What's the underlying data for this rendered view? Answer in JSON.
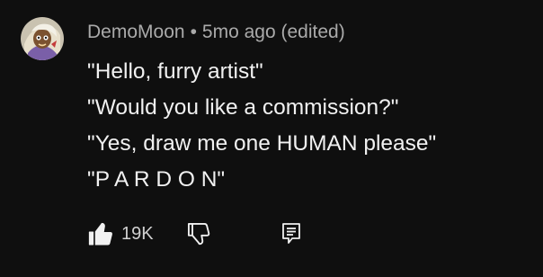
{
  "comment": {
    "author": "DemoMoon",
    "separator": "•",
    "timestamp": "5mo ago (edited)",
    "lines": [
      "\"Hello, furry artist\"",
      "\"Would you like a commission?\"",
      "\"Yes, draw me one HUMAN please\"",
      "\"P A R D O N\""
    ],
    "like_count": "19K"
  },
  "icons": {
    "like": "thumbs-up-icon",
    "dislike": "thumbs-down-icon",
    "reply": "reply-comment-icon",
    "avatar": "avatar-image"
  },
  "colors": {
    "background": "#0f0f0f",
    "text_primary": "#f1f1f1",
    "text_secondary": "#aaaaaa"
  }
}
